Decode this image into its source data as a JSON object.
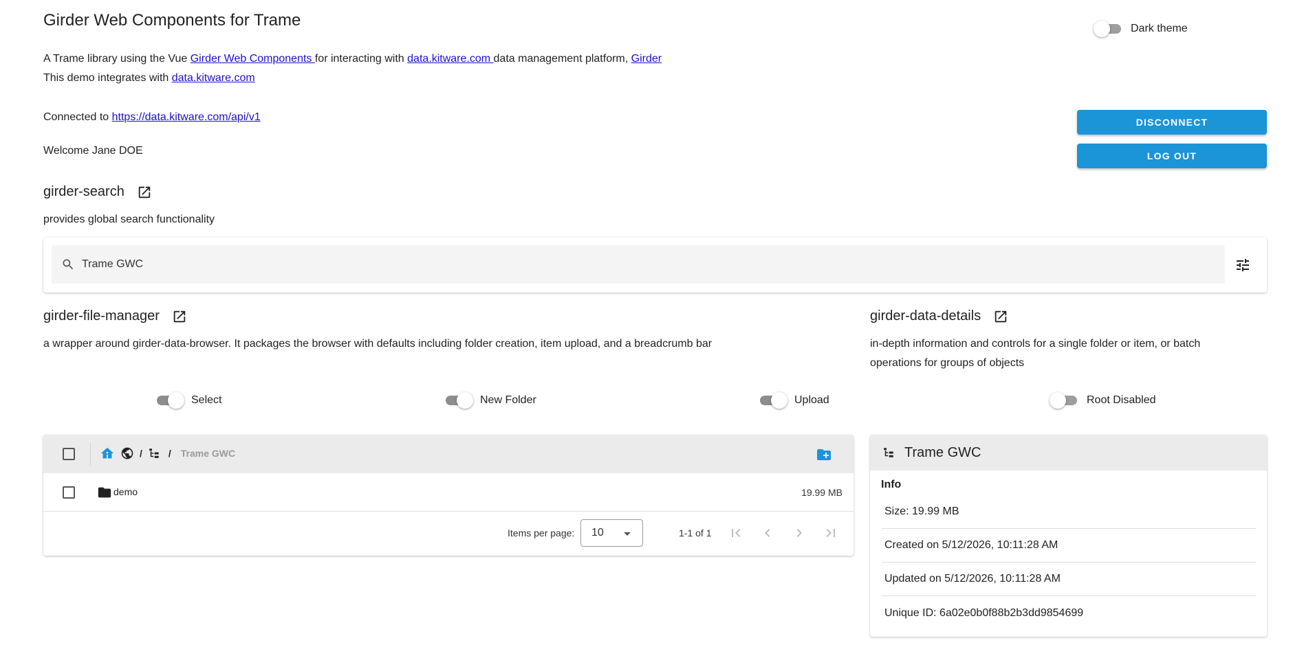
{
  "header": {
    "title": "Girder Web Components for Trame",
    "dark_theme_label": "Dark theme"
  },
  "intro": {
    "line1_prefix": "A Trame library using the Vue ",
    "link_gwc": "Girder Web Components ",
    "line1_mid": "for interacting with ",
    "link_dkc": "data.kitware.com ",
    "line1_mid2": "data management platform, ",
    "link_girder": "Girder",
    "line2_prefix": "This demo integrates with ",
    "link_dkc2": "data.kitware.com"
  },
  "connection": {
    "connected_prefix": "Connected to ",
    "url": "https://data.kitware.com/api/v1",
    "welcome": "Welcome Jane DOE",
    "disconnect_label": "DISCONNECT",
    "logout_label": "LOG OUT"
  },
  "search_section": {
    "heading": "girder-search",
    "description": "provides global search functionality",
    "query": "Trame GWC"
  },
  "file_manager": {
    "heading": "girder-file-manager",
    "description": "a wrapper around girder-data-browser. It packages the browser with defaults including folder creation, item upload, and a breadcrumb bar",
    "toggles": [
      {
        "label": "Select",
        "on": true
      },
      {
        "label": "New Folder",
        "on": true
      },
      {
        "label": "Upload",
        "on": true
      }
    ],
    "breadcrumb_sep": "/",
    "breadcrumb_current": "Trame GWC",
    "rows": [
      {
        "name": "demo",
        "size": "19.99 MB"
      }
    ],
    "footer": {
      "items_per_page_label": "Items per page:",
      "items_per_page_value": "10",
      "range": "1-1 of 1"
    }
  },
  "data_details": {
    "heading": "girder-data-details",
    "description_line1": "in-depth information and controls for a single folder or item, or batch",
    "description_line2": "operations for groups of objects",
    "toggle": {
      "label": "Root Disabled",
      "on": false
    },
    "card_title": "Trame GWC",
    "info_label": "Info",
    "lines": [
      "Size: 19.99 MB",
      "Created on 5/12/2026, 10:11:28 AM",
      "Updated on 5/12/2026, 10:11:28 AM",
      "Unique ID: 6a02e0b0f88b2b3dd9854699"
    ]
  },
  "colors": {
    "primary": "#1b94d8",
    "header_bg": "#ebebeb",
    "field_bg": "#f4f4f4"
  }
}
